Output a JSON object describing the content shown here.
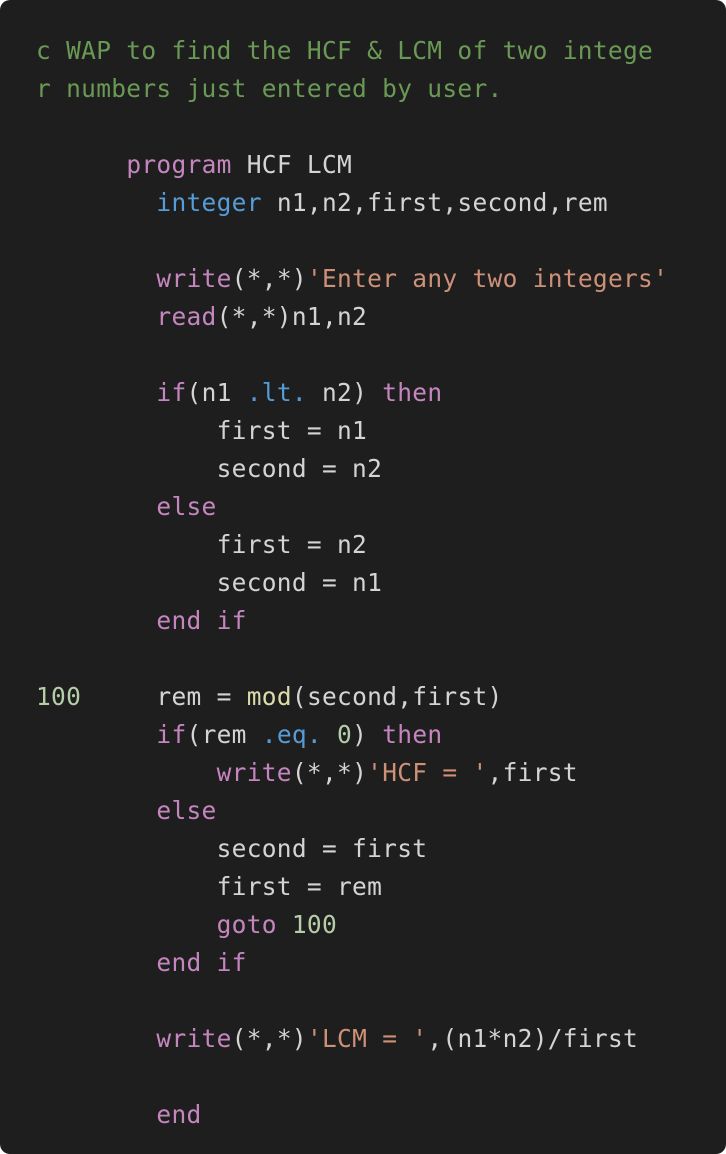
{
  "colors": {
    "background": "#1e1e1e",
    "comment": "#6a9955",
    "keyword": "#c586c0",
    "type": "#569cd6",
    "string": "#ce9178",
    "number": "#b5cea8",
    "function": "#dcdcaa",
    "plain": "#d4d4d4"
  },
  "code": {
    "comment_line1": "c WAP to find the HCF & LCM of two intege",
    "comment_line2": "r numbers just entered by user.",
    "program_indent": "      ",
    "program_kw": "program",
    "program_name": " HCF LCM",
    "decl_indent": "        ",
    "decl_type": "integer",
    "decl_vars": " n1,n2,first,second,rem",
    "write1_kw": "write",
    "write1_args": "(*,*)",
    "write1_str": "'Enter any two integers'",
    "read_kw": "read",
    "read_args": "(*,*)n1,n2",
    "if1_kw": "if",
    "if1_open": "(n1 ",
    "if1_op": ".lt.",
    "if1_close": " n2) ",
    "if1_then": "then",
    "assign1": "            first = n1",
    "assign2": "            second = n2",
    "else1_kw": "else",
    "assign3": "            first = n2",
    "assign4": "            second = n1",
    "endif1_kw": "end if",
    "label_100": "100",
    "label_pad": "     ",
    "rem_lhs": "rem = ",
    "mod_fn": "mod",
    "mod_args": "(second,first)",
    "if2_kw": "if",
    "if2_open": "(rem ",
    "if2_op": ".eq.",
    "if2_sp": " ",
    "if2_zero": "0",
    "if2_close": ") ",
    "if2_then": "then",
    "write2_indent": "            ",
    "write2_kw": "write",
    "write2_args": "(*,*)",
    "write2_str": "'HCF = '",
    "write2_tail": ",first",
    "else2_kw": "else",
    "assign5": "            second = first",
    "assign6": "            first = rem",
    "goto_indent": "            ",
    "goto_kw": "goto",
    "goto_sp": " ",
    "goto_target": "100",
    "endif2_kw": "end if",
    "write3_kw": "write",
    "write3_args": "(*,*)",
    "write3_str": "'LCM = '",
    "write3_tail": ",(n1*n2)/first",
    "end_kw": "end"
  }
}
